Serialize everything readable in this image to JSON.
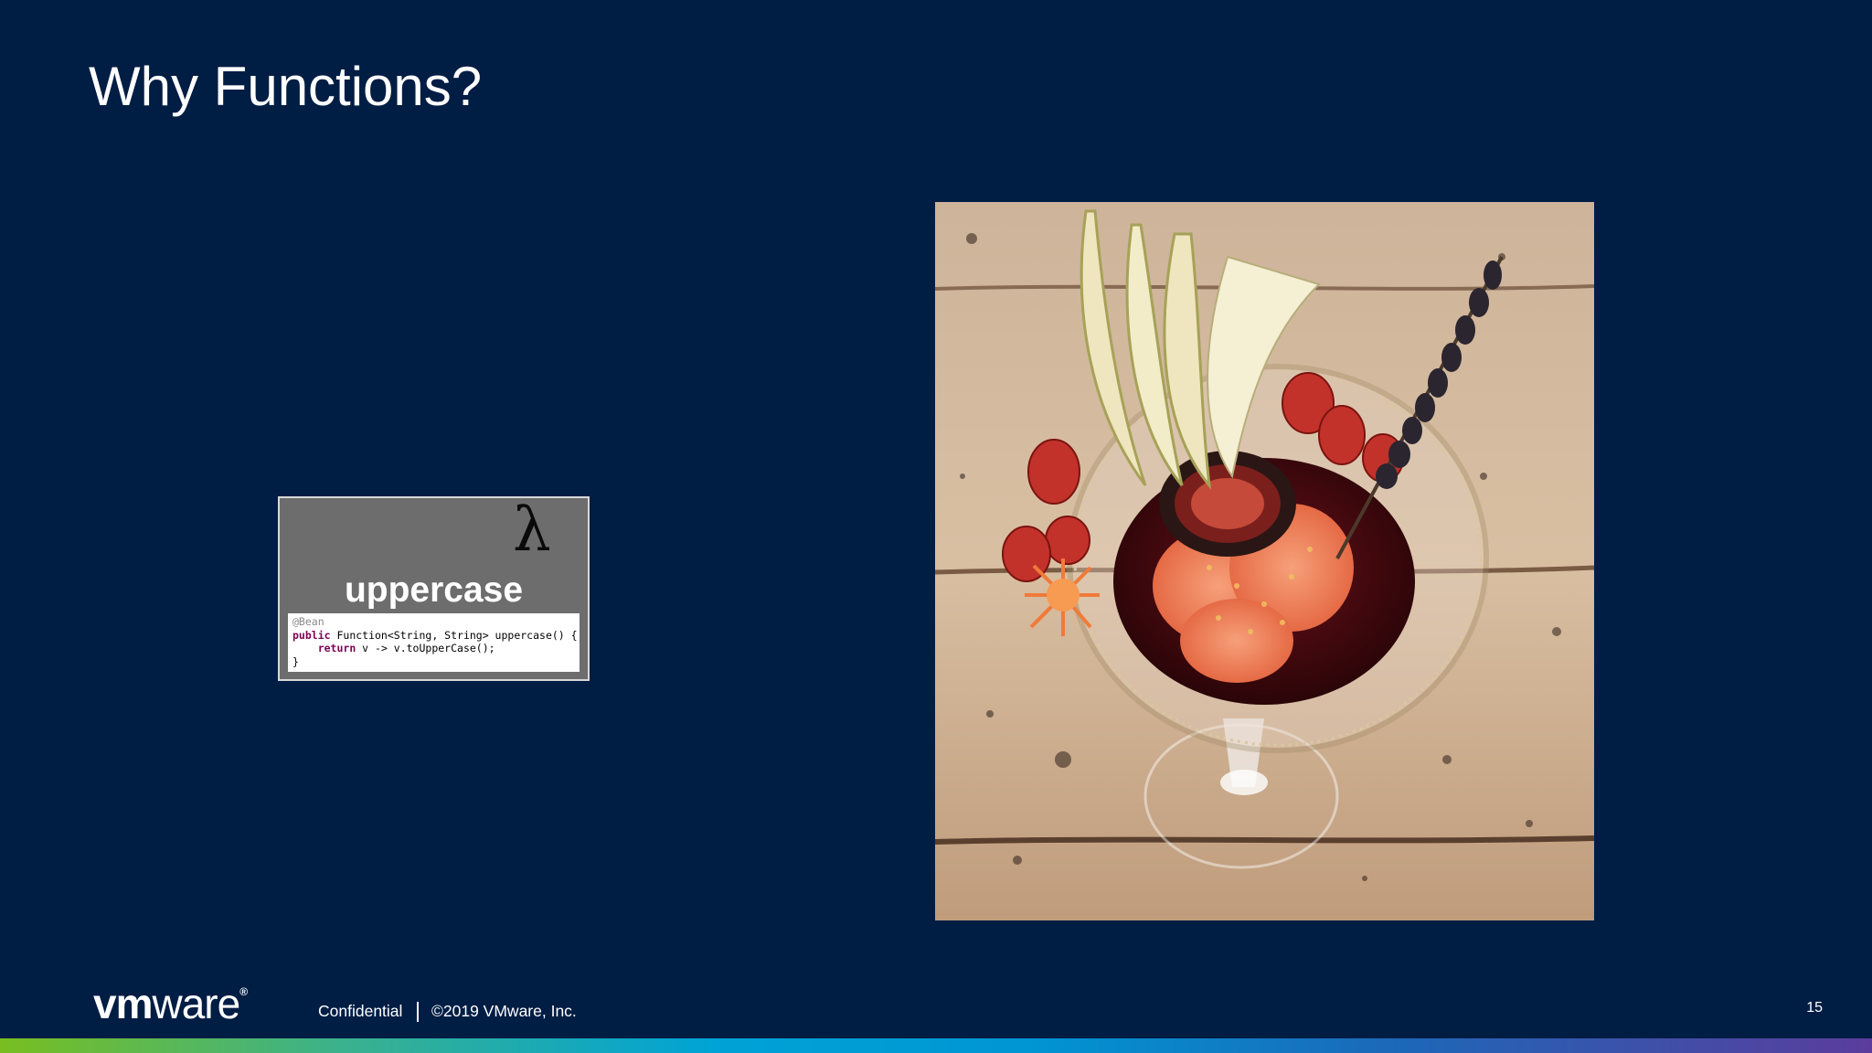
{
  "slide": {
    "title": "Why Functions?",
    "page_number": "15"
  },
  "function_card": {
    "symbol": "λ",
    "name": "uppercase",
    "code": {
      "annotation": "@Bean",
      "line1_keyword": "public",
      "line1_rest": " Function<String, String> uppercase() {",
      "line2_indent": "    ",
      "line2_keyword": "return",
      "line2_rest": " v -> v.toUpperCase();",
      "line3": "}"
    }
  },
  "footer": {
    "logo_bold": "vm",
    "logo_regular": "ware",
    "logo_mark": "®",
    "confidential": "Confidential",
    "copyright": "©2019 VMware, Inc."
  },
  "colors": {
    "background": "#001d44",
    "card_background": "#6d6d6d",
    "keyword": "#7f0055"
  },
  "icons": {
    "photo": "cocktail-glass-dessert-photo",
    "brand": "vmware-logo"
  }
}
